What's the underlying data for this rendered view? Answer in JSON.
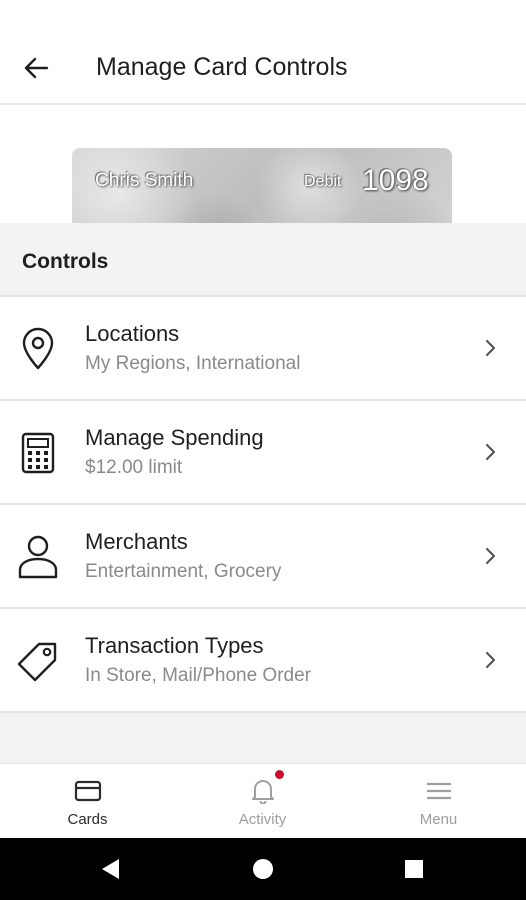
{
  "header": {
    "title": "Manage Card Controls",
    "back_icon": "arrow-left-icon"
  },
  "card": {
    "holder_name": "Chris Smith",
    "type": "Debit",
    "last4": "1098"
  },
  "section": {
    "title": "Controls"
  },
  "controls": [
    {
      "title": "Locations",
      "subtitle": "My Regions, International",
      "icon": "location-pin-icon"
    },
    {
      "title": "Manage Spending",
      "subtitle": "$12.00 limit",
      "icon": "calculator-icon"
    },
    {
      "title": "Merchants",
      "subtitle": "Entertainment, Grocery",
      "icon": "person-icon"
    },
    {
      "title": "Transaction Types",
      "subtitle": "In Store, Mail/Phone Order",
      "icon": "tag-icon"
    }
  ],
  "bottom_nav": {
    "items": [
      {
        "label": "Cards",
        "icon": "card-icon",
        "active": true
      },
      {
        "label": "Activity",
        "icon": "bell-icon",
        "active": false,
        "has_notification": true
      },
      {
        "label": "Menu",
        "icon": "hamburger-icon",
        "active": false
      }
    ]
  },
  "colors": {
    "notification_dot": "#c8102e",
    "section_background": "#f3f3f3",
    "subtitle_text": "#8a8a8a"
  },
  "system_nav": {
    "icons": [
      "back-triangle-icon",
      "home-circle-icon",
      "recents-square-icon"
    ]
  }
}
